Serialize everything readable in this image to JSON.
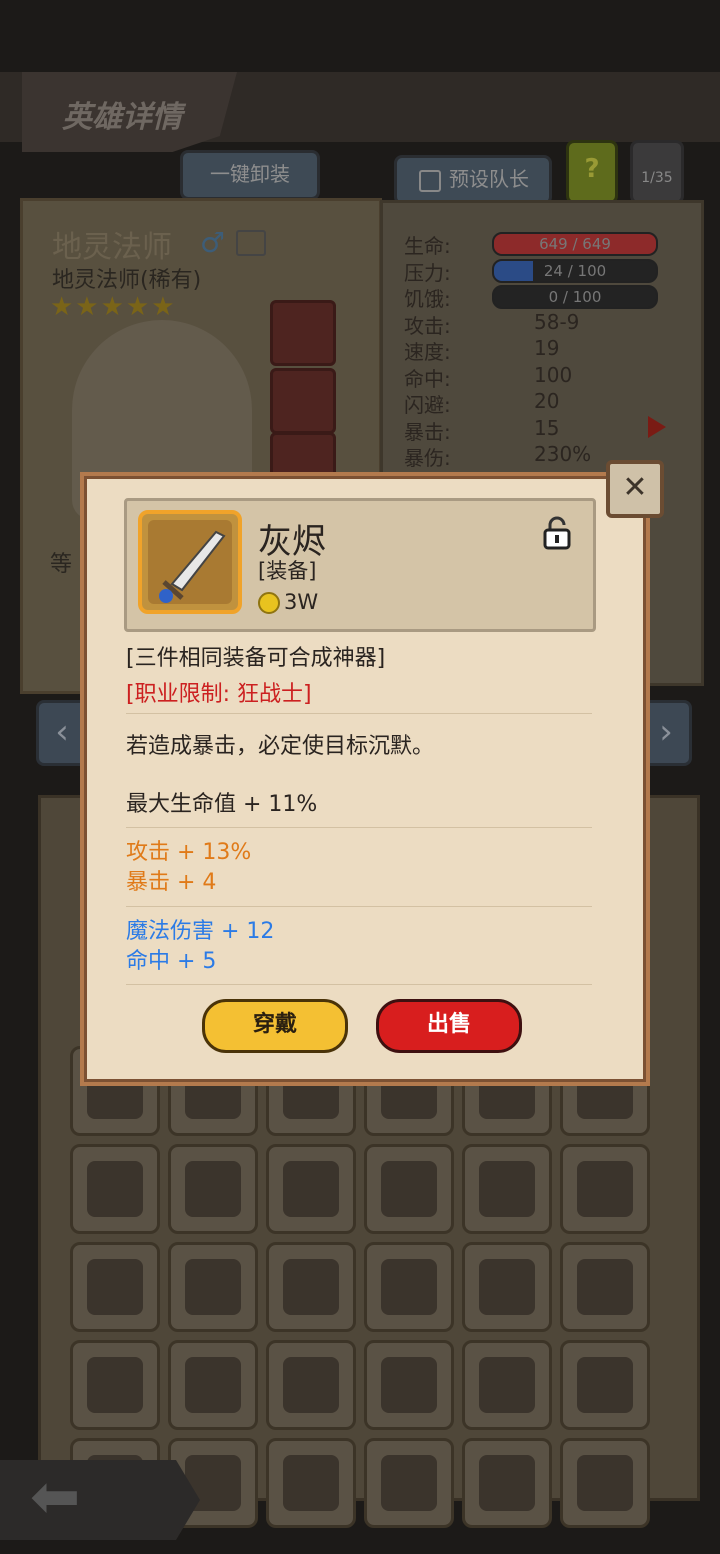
{
  "header": {
    "title": "英雄详情",
    "unequip_all": "一键卸装",
    "preset_leader": "预设队长",
    "help_label": "?",
    "page_counter": "1/35"
  },
  "hero": {
    "name": "地灵法师",
    "class_rarity": "地灵法师(稀有)",
    "stars": "★★★★★",
    "gender_symbol": "♂",
    "level_label_partial": "等"
  },
  "stats": [
    {
      "label": "生命:",
      "value": "649 / 649",
      "bar": true,
      "bar_color": "#8d2a2a",
      "fill": 1.0
    },
    {
      "label": "压力:",
      "value": "24 / 100",
      "bar": true,
      "bar_color": "#2b4b86",
      "fill": 0.24
    },
    {
      "label": "饥饿:",
      "value": "0 / 100",
      "bar": true,
      "bar_color": "#252525",
      "fill": 0.0
    },
    {
      "label": "攻击:",
      "value": "58-9"
    },
    {
      "label": "速度:",
      "value": "19"
    },
    {
      "label": "命中:",
      "value": "100"
    },
    {
      "label": "闪避:",
      "value": "20"
    },
    {
      "label": "暴击:",
      "value": "15"
    },
    {
      "label": "暴伤:",
      "value": "230%"
    }
  ],
  "item": {
    "name": "灰烬",
    "type": "[装备]",
    "price": "3W",
    "set_note": "[三件相同装备可合成神器]",
    "class_limit": "[职业限制: 狂战士]",
    "effect": "若造成暴击，必定使目标沉默。",
    "base_stat": "最大生命值 + 11%",
    "orange_stats": [
      "攻击 + 13%",
      "暴击 + 4"
    ],
    "blue_stats": [
      "魔法伤害 + 12",
      "命中 + 5"
    ],
    "equip_button": "穿戴",
    "sell_button": "出售"
  },
  "colors": {
    "orange_stat": "#e07a18",
    "blue_stat": "#2b7be6",
    "class_limit": "#cc2020",
    "equip_button": "#f4c033",
    "sell_button": "#d81e1e"
  }
}
